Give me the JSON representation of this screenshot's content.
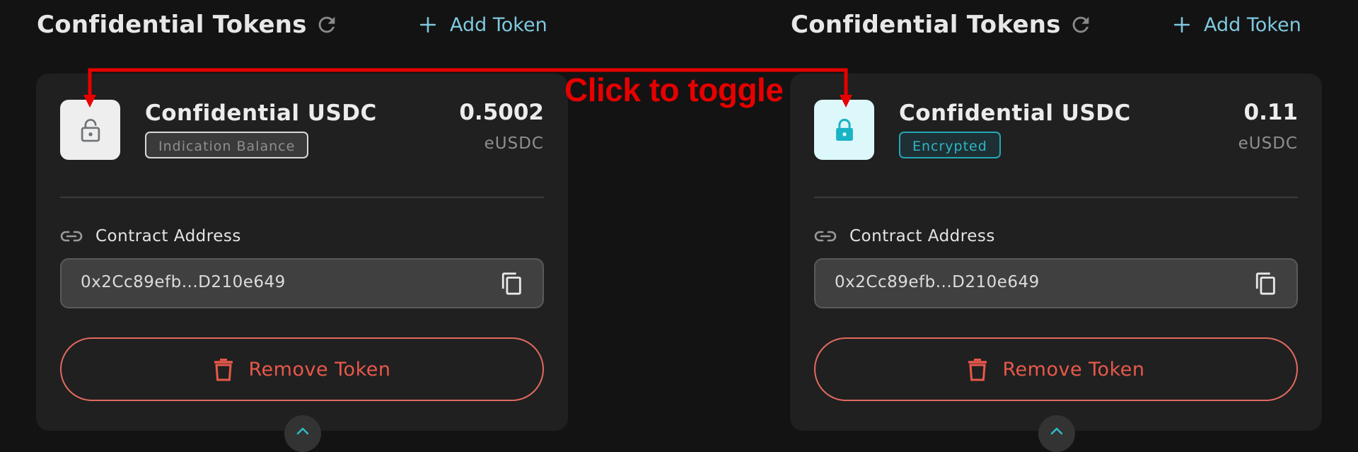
{
  "panels": [
    {
      "header": {
        "title": "Confidential Tokens",
        "add_label": "Add Token"
      },
      "token": {
        "name": "Confidential USDC",
        "badge": "Indication Balance",
        "balance": "0.5002",
        "unit": "eUSDC",
        "lock_state": "unlocked",
        "contract_label": "Contract Address",
        "contract_address": "0x2Cc89efb...D210e649",
        "remove_label": "Remove Token"
      }
    },
    {
      "header": {
        "title": "Confidential Tokens",
        "add_label": "Add Token"
      },
      "token": {
        "name": "Confidential USDC",
        "badge": "Encrypted",
        "balance": "0.11",
        "unit": "eUSDC",
        "lock_state": "locked",
        "contract_label": "Contract Address",
        "contract_address": "0x2Cc89efb...D210e649",
        "remove_label": "Remove Token"
      }
    }
  ],
  "annotation": {
    "text": "Click to toggle"
  },
  "icons": {
    "refresh": "refresh-icon",
    "add": "plus-icon",
    "lock_open": "lock-open-icon",
    "lock_closed": "lock-icon",
    "link": "link-icon",
    "copy": "copy-icon",
    "trash": "trash-icon",
    "chevron": "chevron-up-icon"
  },
  "colors": {
    "background": "#131313",
    "card": "#202020",
    "accent": "#7fc8df",
    "encrypted": "#24a7b6",
    "danger": "#e8584b",
    "annotation": "#e60000"
  }
}
